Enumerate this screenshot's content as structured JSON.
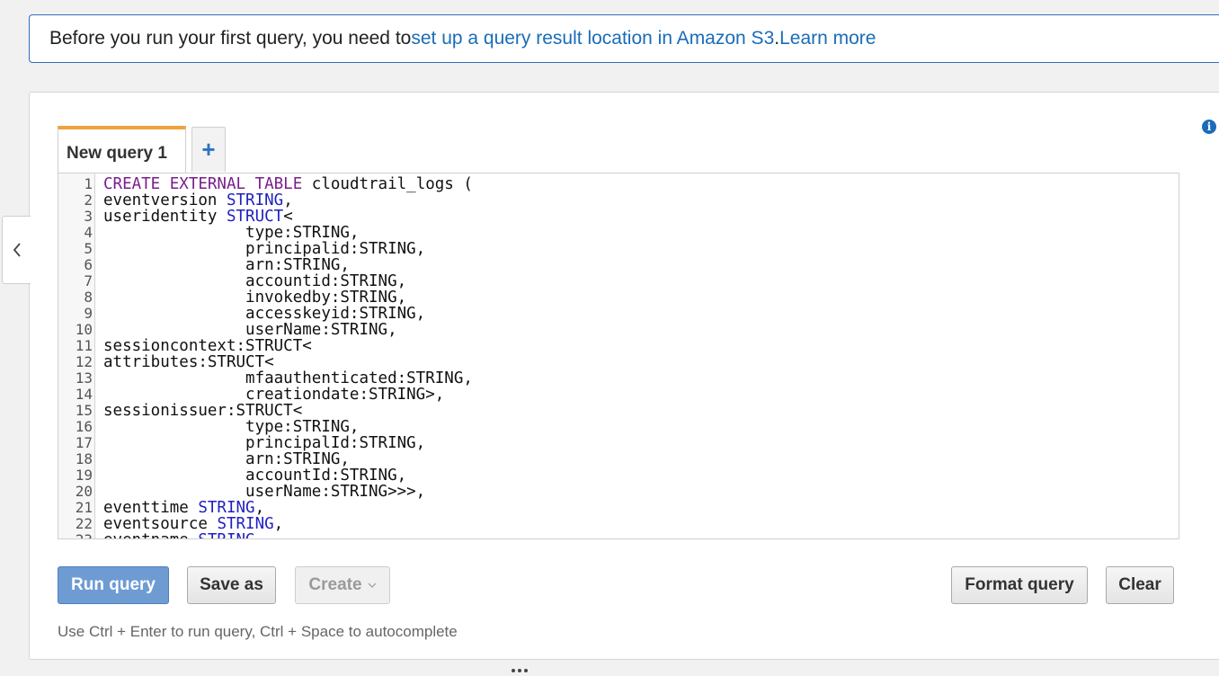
{
  "alert": {
    "text_before": "Before you run your first query, you need to ",
    "link_setup": "set up a query result location in Amazon S3",
    "text_period": ". ",
    "link_learn": "Learn more"
  },
  "tabs": [
    {
      "label": "New query 1",
      "active": true
    }
  ],
  "add_tab_label": "+",
  "info_icon_glyph": "i",
  "editor": {
    "lines": [
      {
        "n": "1",
        "t": [
          {
            "c": "kw",
            "s": "CREATE EXTERNAL TABLE"
          },
          {
            "c": "",
            "s": " cloudtrail_logs ("
          }
        ]
      },
      {
        "n": "2",
        "t": [
          {
            "c": "",
            "s": "eventversion "
          },
          {
            "c": "ty",
            "s": "STRING"
          },
          {
            "c": "",
            "s": ","
          }
        ]
      },
      {
        "n": "3",
        "t": [
          {
            "c": "",
            "s": "useridentity "
          },
          {
            "c": "ty",
            "s": "STRUCT"
          },
          {
            "c": "",
            "s": "<"
          }
        ]
      },
      {
        "n": "4",
        "t": [
          {
            "c": "",
            "s": "               type:STRING,"
          }
        ]
      },
      {
        "n": "5",
        "t": [
          {
            "c": "",
            "s": "               principalid:STRING,"
          }
        ]
      },
      {
        "n": "6",
        "t": [
          {
            "c": "",
            "s": "               arn:STRING,"
          }
        ]
      },
      {
        "n": "7",
        "t": [
          {
            "c": "",
            "s": "               accountid:STRING,"
          }
        ]
      },
      {
        "n": "8",
        "t": [
          {
            "c": "",
            "s": "               invokedby:STRING,"
          }
        ]
      },
      {
        "n": "9",
        "t": [
          {
            "c": "",
            "s": "               accesskeyid:STRING,"
          }
        ]
      },
      {
        "n": "10",
        "t": [
          {
            "c": "",
            "s": "               userName:STRING,"
          }
        ]
      },
      {
        "n": "11",
        "t": [
          {
            "c": "",
            "s": "sessioncontext:STRUCT<"
          }
        ]
      },
      {
        "n": "12",
        "t": [
          {
            "c": "",
            "s": "attributes:STRUCT<"
          }
        ]
      },
      {
        "n": "13",
        "t": [
          {
            "c": "",
            "s": "               mfaauthenticated:STRING,"
          }
        ]
      },
      {
        "n": "14",
        "t": [
          {
            "c": "",
            "s": "               creationdate:STRING>,"
          }
        ]
      },
      {
        "n": "15",
        "t": [
          {
            "c": "",
            "s": "sessionissuer:STRUCT<"
          }
        ]
      },
      {
        "n": "16",
        "t": [
          {
            "c": "",
            "s": "               type:STRING,"
          }
        ]
      },
      {
        "n": "17",
        "t": [
          {
            "c": "",
            "s": "               principalId:STRING,"
          }
        ]
      },
      {
        "n": "18",
        "t": [
          {
            "c": "",
            "s": "               arn:STRING,"
          }
        ]
      },
      {
        "n": "19",
        "t": [
          {
            "c": "",
            "s": "               accountId:STRING,"
          }
        ]
      },
      {
        "n": "20",
        "t": [
          {
            "c": "",
            "s": "               userName:STRING>>>,"
          }
        ]
      },
      {
        "n": "21",
        "t": [
          {
            "c": "",
            "s": "eventtime "
          },
          {
            "c": "ty",
            "s": "STRING"
          },
          {
            "c": "",
            "s": ","
          }
        ]
      },
      {
        "n": "22",
        "t": [
          {
            "c": "",
            "s": "eventsource "
          },
          {
            "c": "ty",
            "s": "STRING"
          },
          {
            "c": "",
            "s": ","
          }
        ]
      },
      {
        "n": "23",
        "t": [
          {
            "c": "",
            "s": "eventname "
          },
          {
            "c": "ty",
            "s": "STRING"
          },
          {
            "c": "",
            "s": ","
          }
        ]
      }
    ]
  },
  "buttons": {
    "run": "Run query",
    "save_as": "Save as",
    "create": "Create",
    "format": "Format query",
    "clear": "Clear"
  },
  "hint": "Use Ctrl + Enter to run query, Ctrl + Space to autocomplete",
  "colors": {
    "accent_tab": "#f0a23c",
    "link": "#1a6cb8",
    "primary_button": "#6f9bd3",
    "keyword": "#7a1e8c",
    "type": "#2020c0"
  },
  "icons": [
    "info-icon",
    "chevron-left-icon",
    "plus-icon",
    "chevron-down-icon",
    "resize-handle-icon"
  ]
}
